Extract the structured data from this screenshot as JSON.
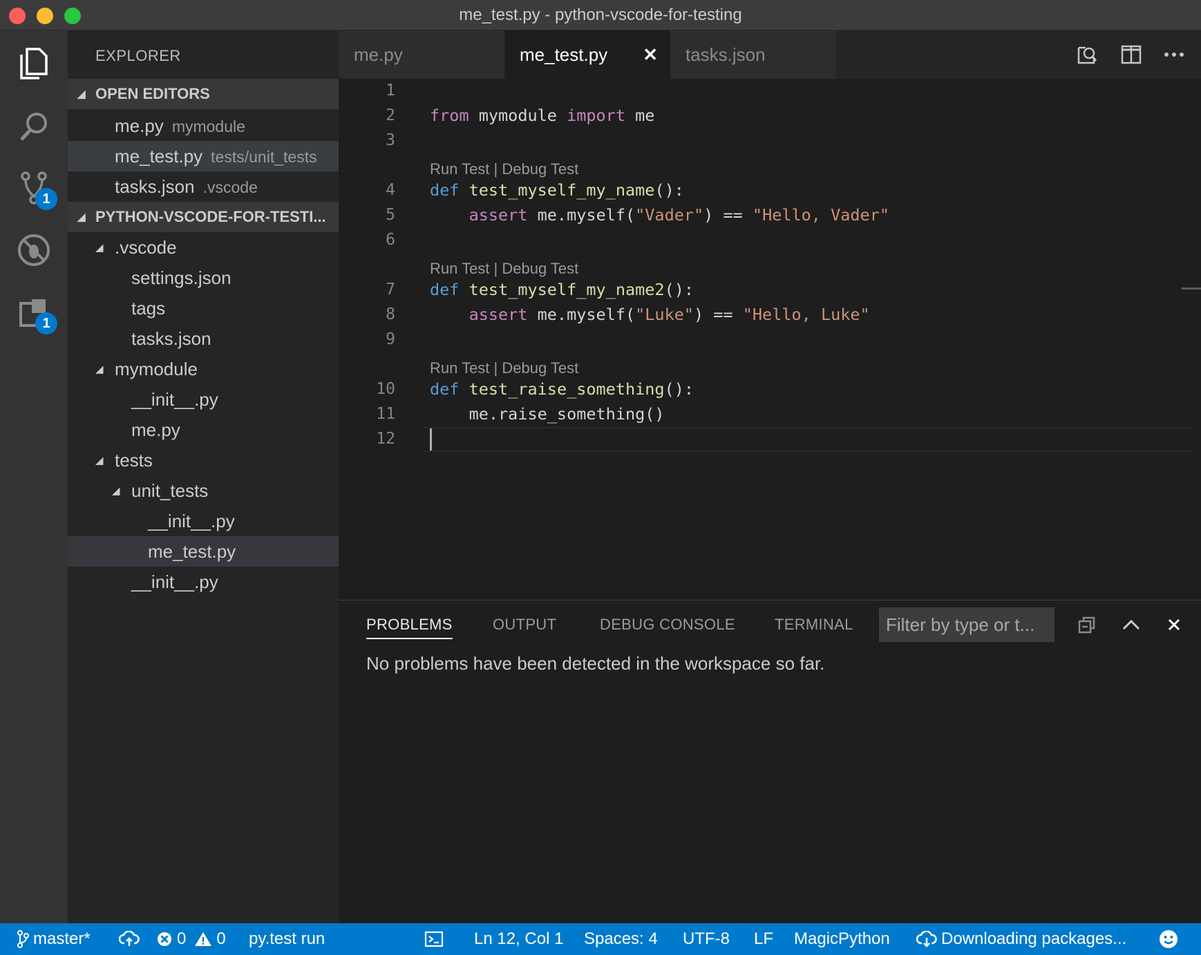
{
  "window": {
    "title": "me_test.py - python-vscode-for-testing"
  },
  "activity_bar": {
    "scm_badge": "1",
    "extensions_badge": "1"
  },
  "sidebar": {
    "title": "EXPLORER",
    "open_editors": {
      "header": "OPEN EDITORS",
      "items": [
        {
          "name": "me.py",
          "desc": "mymodule"
        },
        {
          "name": "me_test.py",
          "desc": "tests/unit_tests"
        },
        {
          "name": "tasks.json",
          "desc": ".vscode"
        }
      ]
    },
    "project": {
      "header": "PYTHON-VSCODE-FOR-TESTI...",
      "items": [
        {
          "name": ".vscode"
        },
        {
          "name": "settings.json"
        },
        {
          "name": "tags"
        },
        {
          "name": "tasks.json"
        },
        {
          "name": "mymodule"
        },
        {
          "name": "__init__.py"
        },
        {
          "name": "me.py"
        },
        {
          "name": "tests"
        },
        {
          "name": "unit_tests"
        },
        {
          "name": "__init__.py"
        },
        {
          "name": "me_test.py"
        },
        {
          "name": "__init__.py"
        }
      ]
    }
  },
  "tabs": [
    {
      "label": "me.py"
    },
    {
      "label": "me_test.py",
      "close": "✕"
    },
    {
      "label": "tasks.json"
    }
  ],
  "editor": {
    "lines": [
      "1",
      "2",
      "3",
      "4",
      "5",
      "6",
      "7",
      "8",
      "9",
      "10",
      "11",
      "12"
    ],
    "codelens": "Run Test | Debug Test",
    "code": {
      "l2": {
        "kw1": "from",
        "t1": " mymodule ",
        "kw2": "import",
        "t2": " me"
      },
      "l4": {
        "def": "def",
        "fn": "test_myself_my_name",
        "rest": "():"
      },
      "l5": {
        "kw": "assert",
        "t1": " me.myself(",
        "s1": "\"Vader\"",
        "t2": ") == ",
        "s2": "\"Hello, Vader\""
      },
      "l7": {
        "def": "def",
        "fn": "test_myself_my_name2",
        "rest": "():"
      },
      "l8": {
        "kw": "assert",
        "t1": " me.myself(",
        "s1": "\"Luke\"",
        "t2": ") == ",
        "s2": "\"Hello, Luke\""
      },
      "l10": {
        "def": "def",
        "fn": "test_raise_something",
        "rest": "():"
      },
      "l11": {
        "t": "me.raise_something()"
      }
    }
  },
  "panel": {
    "tabs": [
      "PROBLEMS",
      "OUTPUT",
      "DEBUG CONSOLE",
      "TERMINAL"
    ],
    "filter_placeholder": "Filter by type or t...",
    "message": "No problems have been detected in the workspace so far."
  },
  "statusbar": {
    "branch": "master*",
    "errors": "0",
    "warnings": "0",
    "task": "py.test run",
    "position": "Ln 12, Col 1",
    "spaces": "Spaces: 4",
    "encoding": "UTF-8",
    "eol": "LF",
    "language": "MagicPython",
    "downloading": "Downloading packages..."
  },
  "colors": {
    "accent": "#007acc",
    "keyword": "#c586c0",
    "def": "#569cd6",
    "function": "#dcdcaa",
    "string": "#ce9178"
  }
}
